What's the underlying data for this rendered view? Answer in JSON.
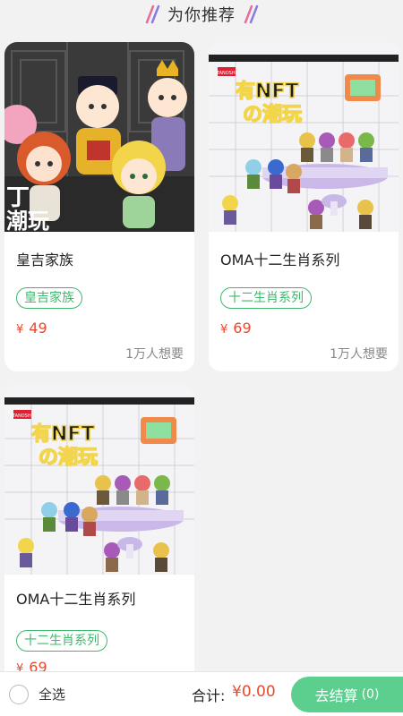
{
  "header": {
    "title": "为你推荐"
  },
  "products": [
    {
      "title": "皇吉家族",
      "tag": "皇吉家族",
      "currency": "¥",
      "price": "49",
      "want": "1万人想要",
      "image": "royal-family-figures"
    },
    {
      "title": "OMA十二生肖系列",
      "tag": "十二生肖系列",
      "currency": "¥",
      "price": "69",
      "want": "1万人想要",
      "image": "oma-zodiac-figures"
    },
    {
      "title": "OMA十二生肖系列",
      "tag": "十二生肖系列",
      "currency": "¥",
      "price": "69",
      "want": "",
      "image": "oma-zodiac-figures"
    }
  ],
  "promo": {
    "headline1": "有NFT",
    "headline2": "の潮玩",
    "brand": "TANOSHI",
    "side_text": "丁\n潮玩"
  },
  "bottom_bar": {
    "select_all": "全选",
    "total_label": "合计:",
    "total_amount": "¥0.00",
    "checkout_label": "去结算",
    "checkout_count": "(0)"
  },
  "colors": {
    "accent_green": "#3db86b",
    "price_red": "#e8492f",
    "checkout_bg": "#5ccf8f"
  }
}
